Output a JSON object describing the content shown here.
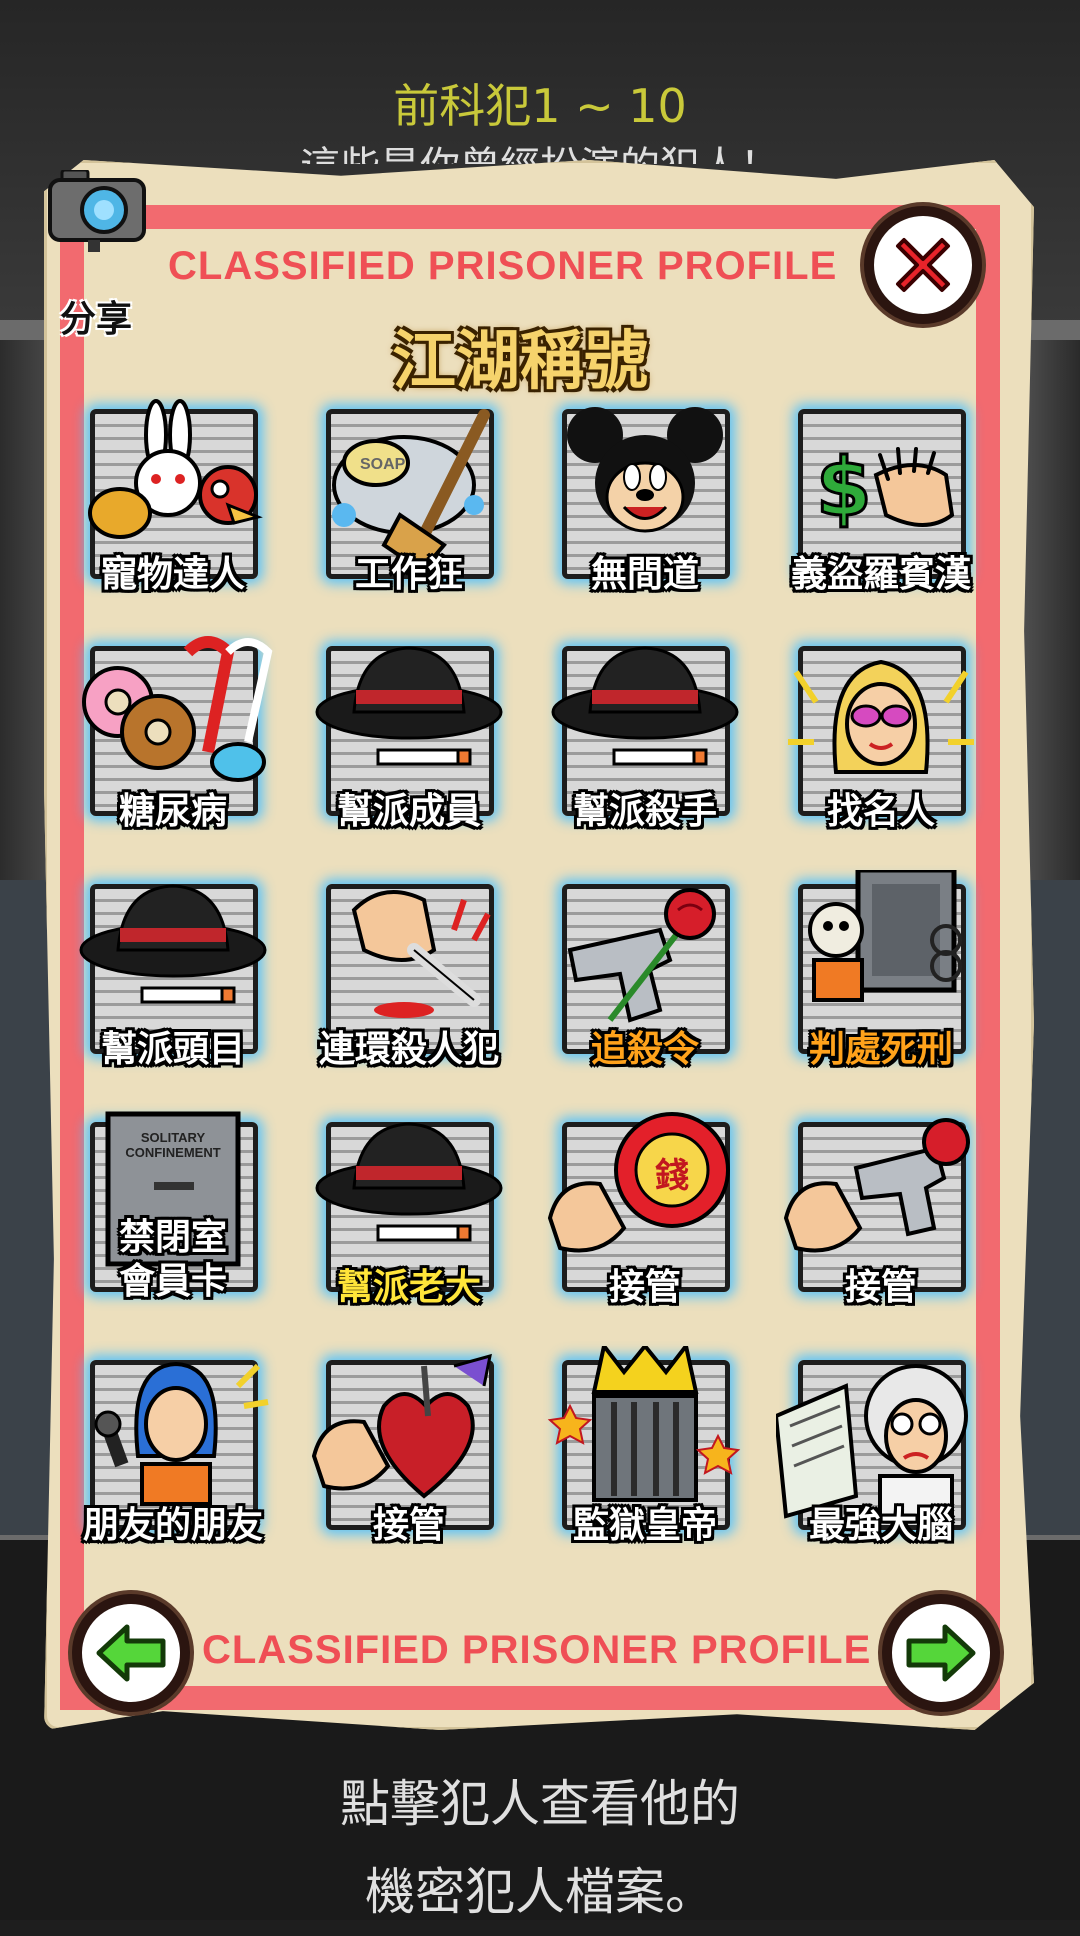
{
  "header": {
    "title": "前科犯1 ~ 10",
    "subtitle": "這些是你曾經扮演的犯人！"
  },
  "card": {
    "top_label": "CLASSIFIED PRISONER PROFILE",
    "bottom_label": "CLASSIFIED PRISONER PROFILE",
    "section_title": "江湖稱號",
    "share_label": "分享"
  },
  "tiles": [
    {
      "label": "寵物達人",
      "icon": "pets-icon",
      "color": "white"
    },
    {
      "label": "工作狂",
      "icon": "soap-broom-icon",
      "color": "white"
    },
    {
      "label": "無間道",
      "icon": "mouse-face-icon",
      "color": "white"
    },
    {
      "label": "義盜羅賓漢",
      "icon": "money-hand-icon",
      "color": "white"
    },
    {
      "label": "糖尿病",
      "icon": "candy-icon",
      "color": "white"
    },
    {
      "label": "幫派成員",
      "icon": "fedora-icon",
      "color": "white"
    },
    {
      "label": "幫派殺手",
      "icon": "fedora-icon",
      "color": "white"
    },
    {
      "label": "找名人",
      "icon": "celebrity-icon",
      "color": "white"
    },
    {
      "label": "幫派頭目",
      "icon": "fedora-icon",
      "color": "white"
    },
    {
      "label": "連環殺人犯",
      "icon": "fist-knife-icon",
      "color": "white"
    },
    {
      "label": "追殺令",
      "icon": "gun-rose-icon",
      "color": "orange"
    },
    {
      "label": "判處死刑",
      "icon": "skeleton-icon",
      "color": "orange"
    },
    {
      "label": "禁閉室\n會員卡",
      "icon": "solitary-door-icon",
      "color": "white",
      "door_text": "SOLITARY CONFINEMENT"
    },
    {
      "label": "幫派老大",
      "icon": "fedora-icon",
      "color": "yellow"
    },
    {
      "label": "接管",
      "icon": "fist-coin-icon",
      "color": "white",
      "coin_text": "錢"
    },
    {
      "label": "接管",
      "icon": "fist-gun-rose-icon",
      "color": "white"
    },
    {
      "label": "朋友的朋友",
      "icon": "singer-icon",
      "color": "white"
    },
    {
      "label": "接管",
      "icon": "fist-heart-icon",
      "color": "white"
    },
    {
      "label": "監獄皇帝",
      "icon": "crown-bars-icon",
      "color": "white"
    },
    {
      "label": "最強大腦",
      "icon": "professor-icon",
      "color": "white"
    }
  ],
  "footer": {
    "hint_line1": "點擊犯人查看他的",
    "hint_line2": "機密犯人檔案。"
  },
  "colors": {
    "frame_red": "#f26a6f",
    "label_red": "#ef4f55",
    "tile_glow": "#46beff",
    "arrow_green": "#55d63a",
    "close_red": "#e8232a"
  }
}
